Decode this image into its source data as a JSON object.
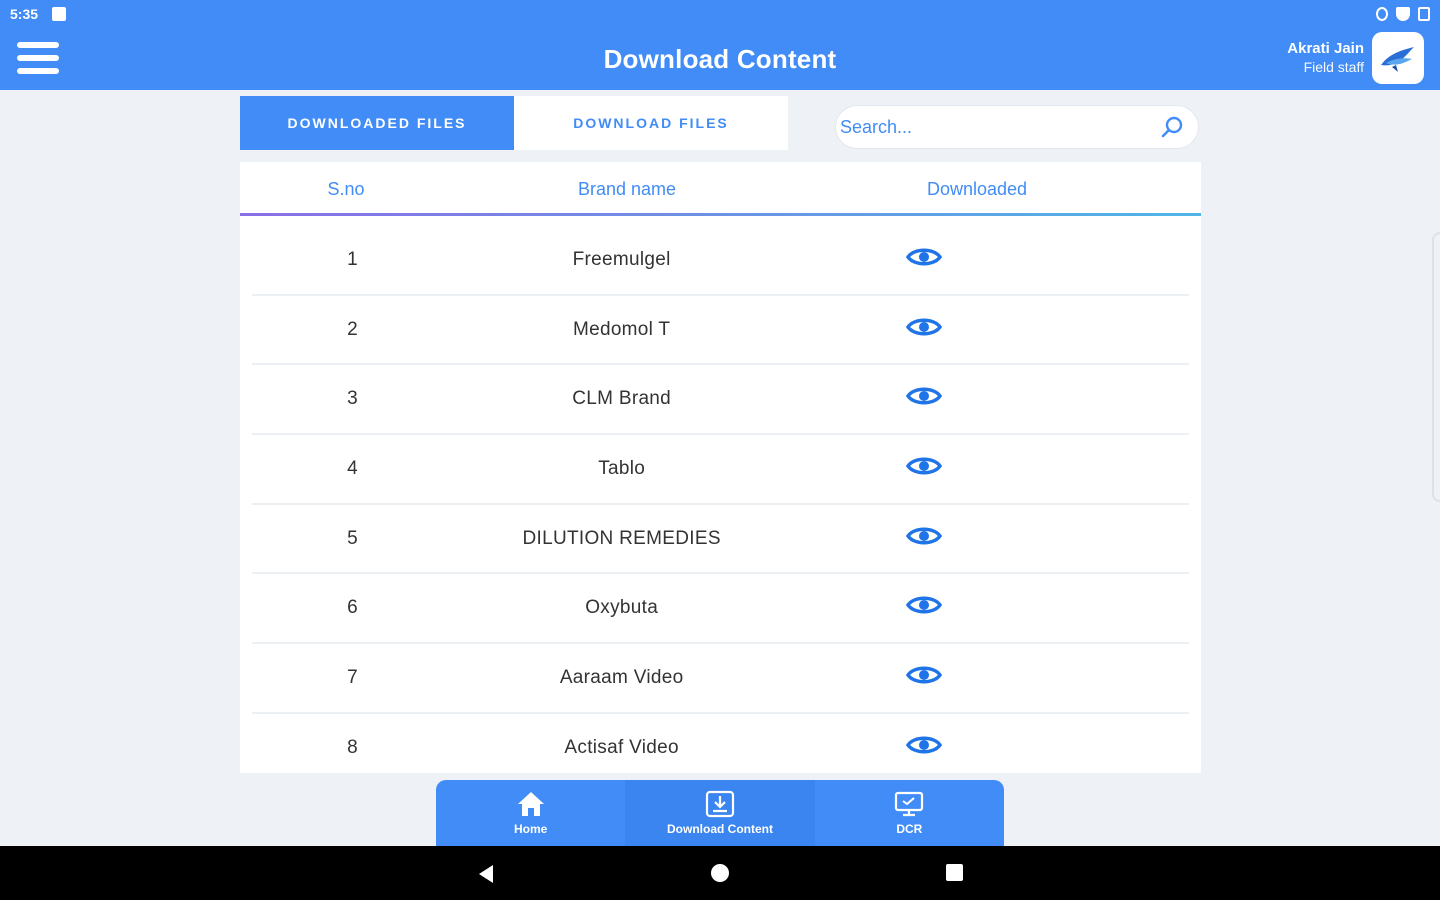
{
  "status": {
    "time": "5:35"
  },
  "header": {
    "title": "Download Content",
    "user_name": "Akrati Jain",
    "user_role": "Field staff"
  },
  "tabs": [
    {
      "label": "DOWNLOADED FILES",
      "active": true
    },
    {
      "label": "DOWNLOAD FILES",
      "active": false
    }
  ],
  "search": {
    "placeholder": "Search..."
  },
  "table": {
    "headers": [
      "S.no",
      "Brand name",
      "Downloaded"
    ],
    "rows": [
      {
        "sno": "1",
        "brand": "Freemulgel"
      },
      {
        "sno": "2",
        "brand": "Medomol T"
      },
      {
        "sno": "3",
        "brand": "CLM Brand"
      },
      {
        "sno": "4",
        "brand": "Tablo"
      },
      {
        "sno": "5",
        "brand": "DILUTION REMEDIES"
      },
      {
        "sno": "6",
        "brand": "Oxybuta"
      },
      {
        "sno": "7",
        "brand": "Aaraam Video"
      },
      {
        "sno": "8",
        "brand": "Actisaf Video"
      }
    ]
  },
  "bottom_nav": [
    {
      "label": "Home",
      "icon": "home-icon"
    },
    {
      "label": "Download Content",
      "icon": "download-icon"
    },
    {
      "label": "DCR",
      "icon": "monitor-icon"
    }
  ],
  "colors": {
    "primary": "#418cf6",
    "eye": "#1f74e8"
  }
}
